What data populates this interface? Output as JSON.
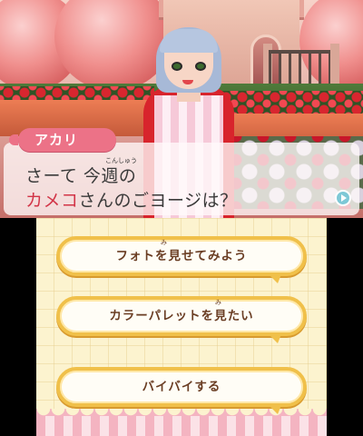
{
  "dialog": {
    "speaker": "アカリ",
    "line1": "さーて 今週の",
    "line1_ruby": "こんしゅう",
    "line2_highlight": "カメコ",
    "line2_rest": "さんのごヨージは？"
  },
  "menu": {
    "photo": {
      "label": "フォトを見せてみよう",
      "ruby": "み"
    },
    "palette": {
      "label": "カラーパレットを見たい",
      "ruby": "み"
    },
    "bye": {
      "label": "バイバイする"
    }
  },
  "colors": {
    "speaker_tag": "#ec7287",
    "dialog_highlight": "#d23447",
    "button_border": "#f0c04a",
    "button_text": "#6a3d23"
  },
  "icons": {
    "advance": "advance-arrow-icon"
  }
}
